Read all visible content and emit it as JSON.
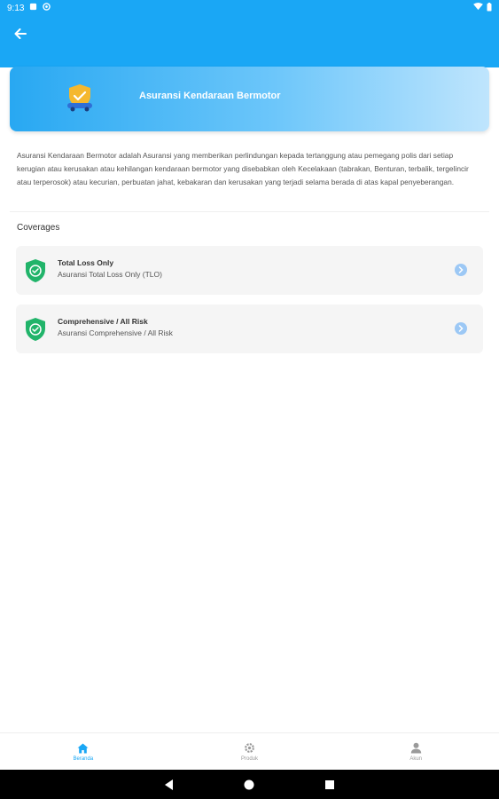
{
  "status_bar": {
    "time": "9:13"
  },
  "header": {
    "title": "Asuransi Kendaraan Bermotor"
  },
  "description": "Asuransi Kendaraan Bermotor adalah Asuransi yang memberikan perlindungan kepada tertanggung atau pemegang polis dari setiap kerugian atau kerusakan atau kehilangan kendaraan bermotor yang disebabkan oleh Kecelakaan (tabrakan, Benturan, terbalik, tergelincir atau terperosok) atau kecurian, perbuatan jahat, kebakaran dan kerusakan yang terjadi selama berada di atas kapal penyeberangan.",
  "coverages": {
    "title": "Coverages",
    "items": [
      {
        "title": "Total Loss Only",
        "subtitle": "Asuransi Total Loss Only (TLO)"
      },
      {
        "title": "Comprehensive / All Risk",
        "subtitle": "Asuransi Comprehensive / All Risk"
      }
    ]
  },
  "bottom_nav": {
    "items": [
      {
        "label": "Beranda",
        "icon": "home-icon",
        "active": true
      },
      {
        "label": "Produk",
        "icon": "gear-icon",
        "active": false
      },
      {
        "label": "Akun",
        "icon": "person-icon",
        "active": false
      }
    ]
  },
  "colors": {
    "primary": "#1aa7f5",
    "shield_green": "#21b46a"
  }
}
